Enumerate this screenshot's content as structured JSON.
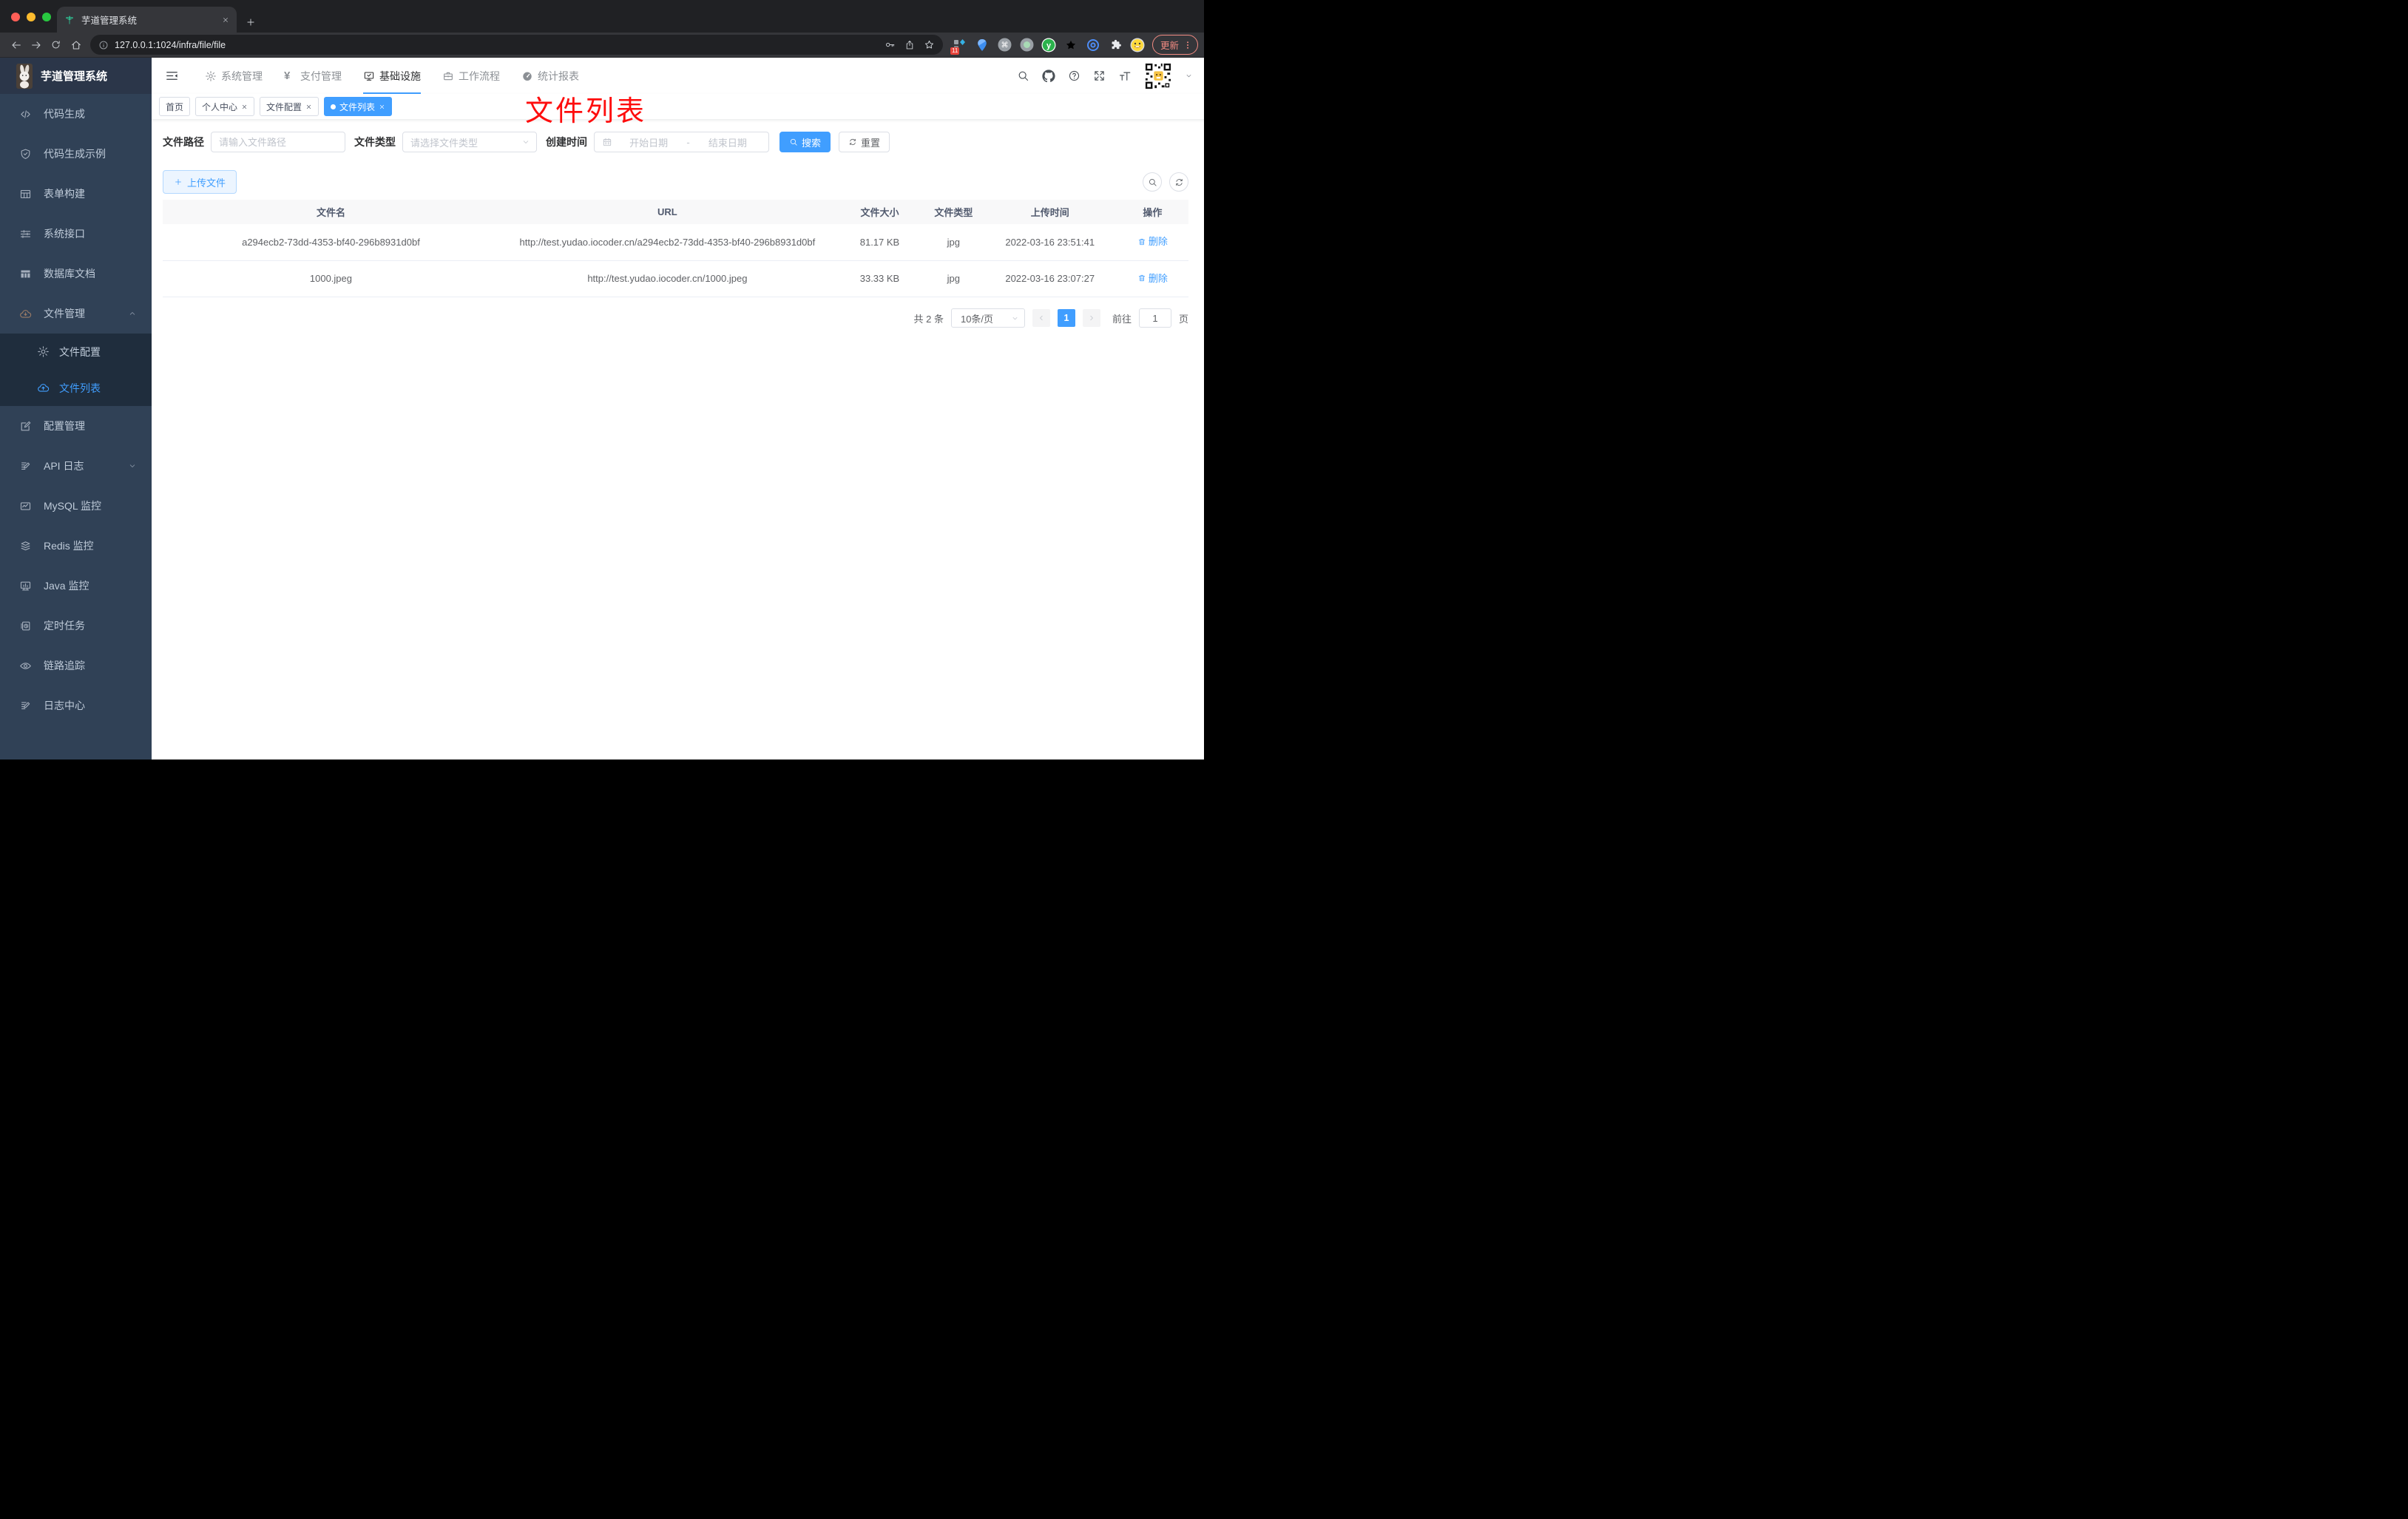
{
  "browser": {
    "tab_title": "芋道管理系统",
    "url": "127.0.0.1:1024/infra/file/file",
    "extension_badge": "11",
    "update_label": "更新"
  },
  "annotation": "文件列表",
  "app": {
    "brand": "芋道管理系统",
    "top_nav": [
      {
        "label": "系统管理",
        "icon": "gear",
        "active": false
      },
      {
        "label": "支付管理",
        "icon": "yen",
        "active": false
      },
      {
        "label": "基础设施",
        "icon": "monitor",
        "active": true
      },
      {
        "label": "工作流程",
        "icon": "briefcase",
        "active": false
      },
      {
        "label": "统计报表",
        "icon": "gauge",
        "active": false
      }
    ]
  },
  "sidebar": {
    "items": [
      {
        "label": "代码生成",
        "icon": "code"
      },
      {
        "label": "代码生成示例",
        "icon": "shield-check"
      },
      {
        "label": "表单构建",
        "icon": "form-grid"
      },
      {
        "label": "系统接口",
        "icon": "sliders"
      },
      {
        "label": "数据库文档",
        "icon": "table"
      },
      {
        "label": "文件管理",
        "icon": "cloud-download",
        "icon_tint": "#9a7b66",
        "expandable": true,
        "expanded": true,
        "children": [
          {
            "label": "文件配置",
            "icon": "gear",
            "active": false
          },
          {
            "label": "文件列表",
            "icon": "cloud-upload",
            "active": true
          }
        ]
      },
      {
        "label": "配置管理",
        "icon": "edit-square"
      },
      {
        "label": "API 日志",
        "icon": "note-edit",
        "expandable": true,
        "expanded": false
      },
      {
        "label": "MySQL 监控",
        "icon": "chart-monitor"
      },
      {
        "label": "Redis 监控",
        "icon": "layers"
      },
      {
        "label": "Java 监控",
        "icon": "monitor-bar"
      },
      {
        "label": "定时任务",
        "icon": "schedule"
      },
      {
        "label": "链路追踪",
        "icon": "eye"
      },
      {
        "label": "日志中心",
        "icon": "log-edit"
      }
    ]
  },
  "tags": [
    {
      "label": "首页",
      "closable": false,
      "active": false
    },
    {
      "label": "个人中心",
      "closable": true,
      "active": false
    },
    {
      "label": "文件配置",
      "closable": true,
      "active": false
    },
    {
      "label": "文件列表",
      "closable": true,
      "active": true
    }
  ],
  "filters": {
    "path_label": "文件路径",
    "path_placeholder": "请输入文件路径",
    "type_label": "文件类型",
    "type_placeholder": "请选择文件类型",
    "date_label": "创建时间",
    "date_start_placeholder": "开始日期",
    "date_separator": "-",
    "date_end_placeholder": "结束日期",
    "search_label": "搜索",
    "reset_label": "重置"
  },
  "toolbar": {
    "upload_label": "上传文件"
  },
  "table": {
    "headers": [
      "文件名",
      "URL",
      "文件大小",
      "文件类型",
      "上传时间",
      "操作"
    ],
    "rows": [
      {
        "name": "a294ecb2-73dd-4353-bf40-296b8931d0bf",
        "url": "http://test.yudao.iocoder.cn/a294ecb2-73dd-4353-bf40-296b8931d0bf",
        "size": "81.17 KB",
        "type": "jpg",
        "time": "2022-03-16 23:51:41",
        "action": "删除"
      },
      {
        "name": "1000.jpeg",
        "url": "http://test.yudao.iocoder.cn/1000.jpeg",
        "size": "33.33 KB",
        "type": "jpg",
        "time": "2022-03-16 23:07:27",
        "action": "删除"
      }
    ]
  },
  "pagination": {
    "total": "共 2 条",
    "page_size": "10条/页",
    "current_page": "1",
    "goto_label": "前往",
    "goto_value": "1",
    "page_unit": "页"
  },
  "colors": {
    "accent": "#409eff",
    "annotation": "#fe0d0d",
    "sidebar_bg": "#304156",
    "sidebar_sub_bg": "#1f2d3d"
  }
}
